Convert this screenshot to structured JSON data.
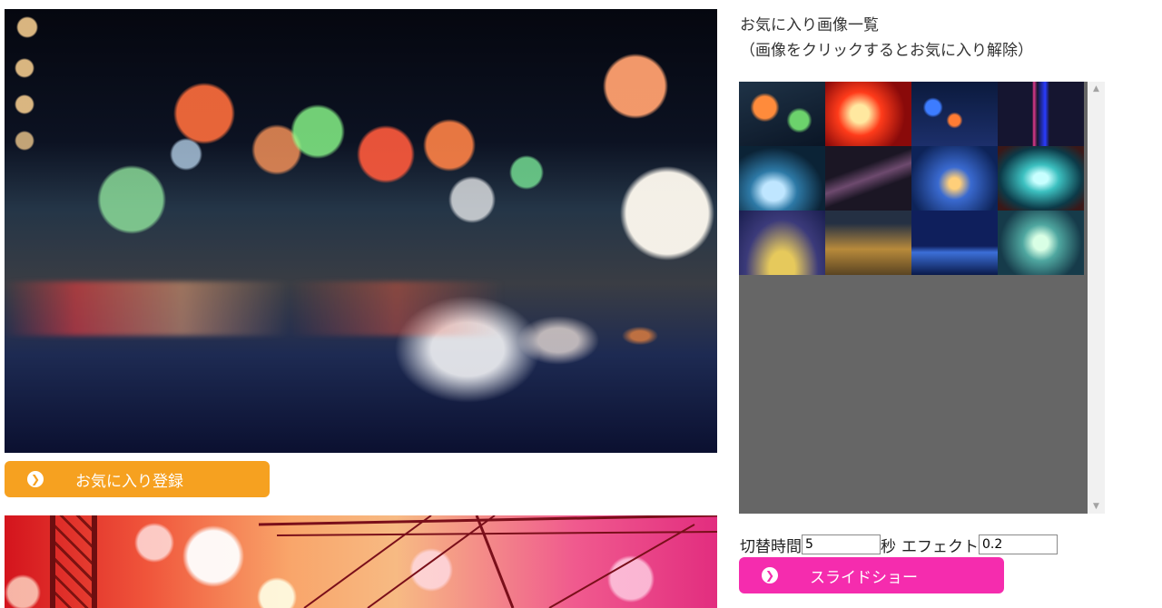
{
  "register_button": {
    "label": "お気に入り登録",
    "icon": "chevron-right-circle-icon"
  },
  "favorites": {
    "title_line1": "お気に入り画像一覧",
    "title_line2": "（画像をクリックするとお気に入り解除）",
    "thumbnail_count": 12
  },
  "controls": {
    "switch_time_label": "切替時間",
    "switch_time_value": "5",
    "seconds_unit": "秒",
    "effect_label": "エフェクト",
    "effect_value": "0.2"
  },
  "slideshow_button": {
    "label": "スライドショー",
    "icon": "chevron-right-circle-icon"
  },
  "colors": {
    "register_button": "#f6a120",
    "slideshow_button": "#f52cae",
    "favorites_panel": "#666666"
  }
}
